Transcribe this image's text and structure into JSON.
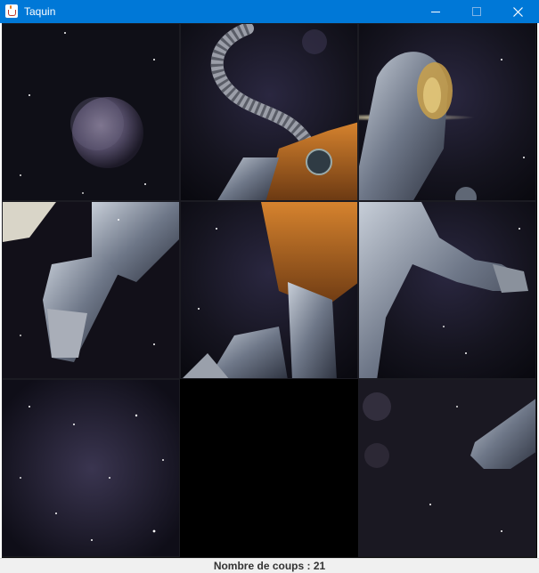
{
  "window": {
    "title": "Taquin",
    "titlebar_color": "#0078d7",
    "app_icon": "java-cup-icon",
    "controls": [
      "minimize-icon",
      "maximize-icon",
      "close-icon"
    ]
  },
  "board": {
    "grid_size": 3,
    "empty_position": {
      "row": 3,
      "col": 2
    },
    "tile_count": 8
  },
  "status": {
    "text": "Nombre de coups : 21"
  }
}
